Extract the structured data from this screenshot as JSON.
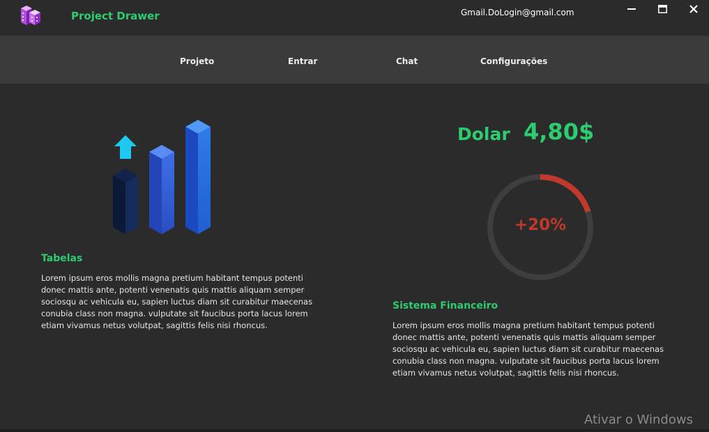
{
  "app": {
    "title": "Project Drawer",
    "account_email": "Gmail.DoLogin@gmail.com",
    "logo_icon": "purple-buildings-logo-icon"
  },
  "window_controls": {
    "minimize_icon": "minimize-icon",
    "maximize_icon": "maximize-icon",
    "close_icon": "close-icon"
  },
  "nav": {
    "items": [
      {
        "label": "Projeto"
      },
      {
        "label": "Entrar"
      },
      {
        "label": "Chat"
      },
      {
        "label": "Configurações"
      }
    ]
  },
  "tabelas": {
    "icon": "bar-chart-growth-icon",
    "title": "Tabelas",
    "text": "Lorem ipsum eros mollis magna pretium habitant tempus potenti donec mattis ante, potenti venenatis quis mattis aliquam semper sociosqu ac vehicula eu, sapien luctus diam sit curabitur maecenas conubia class non magna. vulputate sit faucibus porta lacus lorem etiam vivamus netus volutpat, sagittis felis nisi rhoncus."
  },
  "financeiro": {
    "currency_label": "Dolar",
    "currency_value": "4,80$",
    "gauge_text": "+20%",
    "gauge_fraction": 0.2,
    "title": "Sistema Financeiro",
    "text": "Lorem ipsum eros mollis magna pretium habitant tempus potenti donec mattis ante, potenti venenatis quis mattis aliquam semper sociosqu ac vehicula eu, sapien luctus diam sit curabitur maecenas conubia class non magna. vulputate sit faucibus porta lacus lorem etiam vivamus netus volutpat, sagittis felis nisi rhoncus."
  },
  "watermark": "Ativar o Windows",
  "colors": {
    "accent": "#2ecc71",
    "gauge_fill": "#c0392b",
    "gauge_track": "#3e3e3e",
    "background": "#2b2b2b",
    "navbar": "#3c3b3b"
  }
}
